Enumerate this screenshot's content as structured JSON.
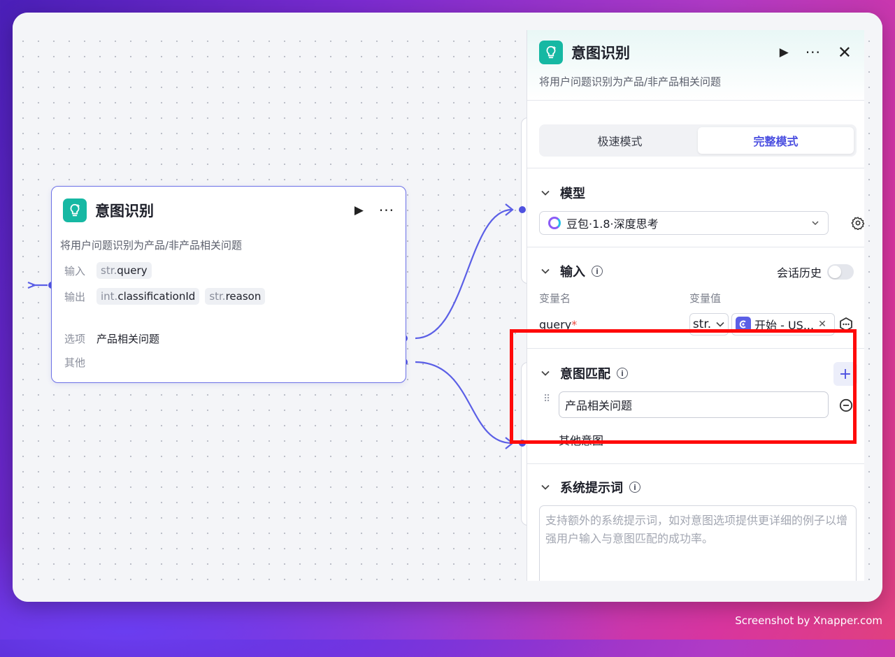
{
  "canvas_node": {
    "title": "意图识别",
    "description": "将用户问题识别为产品/非产品相关问题",
    "input_label": "输入",
    "input_type": "str.",
    "input_name": "query",
    "output_label": "输出",
    "outputs": [
      {
        "type": "int.",
        "name": "classificationId"
      },
      {
        "type": "str.",
        "name": "reason"
      }
    ],
    "option_label": "选项",
    "option_value": "产品相关问题",
    "other_label": "其他"
  },
  "panel": {
    "title": "意图识别",
    "description": "将用户问题识别为产品/非产品相关问题",
    "modes": [
      {
        "label": "极速模式",
        "active": false
      },
      {
        "label": "完整模式",
        "active": true
      }
    ],
    "model_section": {
      "title": "模型",
      "selected_model": "豆包·1.8·深度思考"
    },
    "input_section": {
      "title": "输入",
      "history_label": "会话历史",
      "history_enabled": false,
      "col_name": "变量名",
      "col_value": "变量值",
      "var_name": "query",
      "required_mark": "*",
      "var_type": "str.",
      "var_ref": "开始 - US..."
    },
    "intent_section": {
      "title": "意图匹配",
      "intents": [
        "产品相关问题"
      ],
      "other_intent": "其他意图"
    },
    "prompt_section": {
      "title": "系统提示词",
      "placeholder": "支持额外的系统提示词，如对意图选项提供更详细的例子以增强用户输入与意图匹配的成功率。"
    }
  },
  "watermark": "Screenshot by Xnapper.com",
  "colors": {
    "accent": "#4b4fe0",
    "app_icon": "#16b8a3",
    "highlight": "#ff0a0a",
    "wire": "#5b5fe6"
  }
}
